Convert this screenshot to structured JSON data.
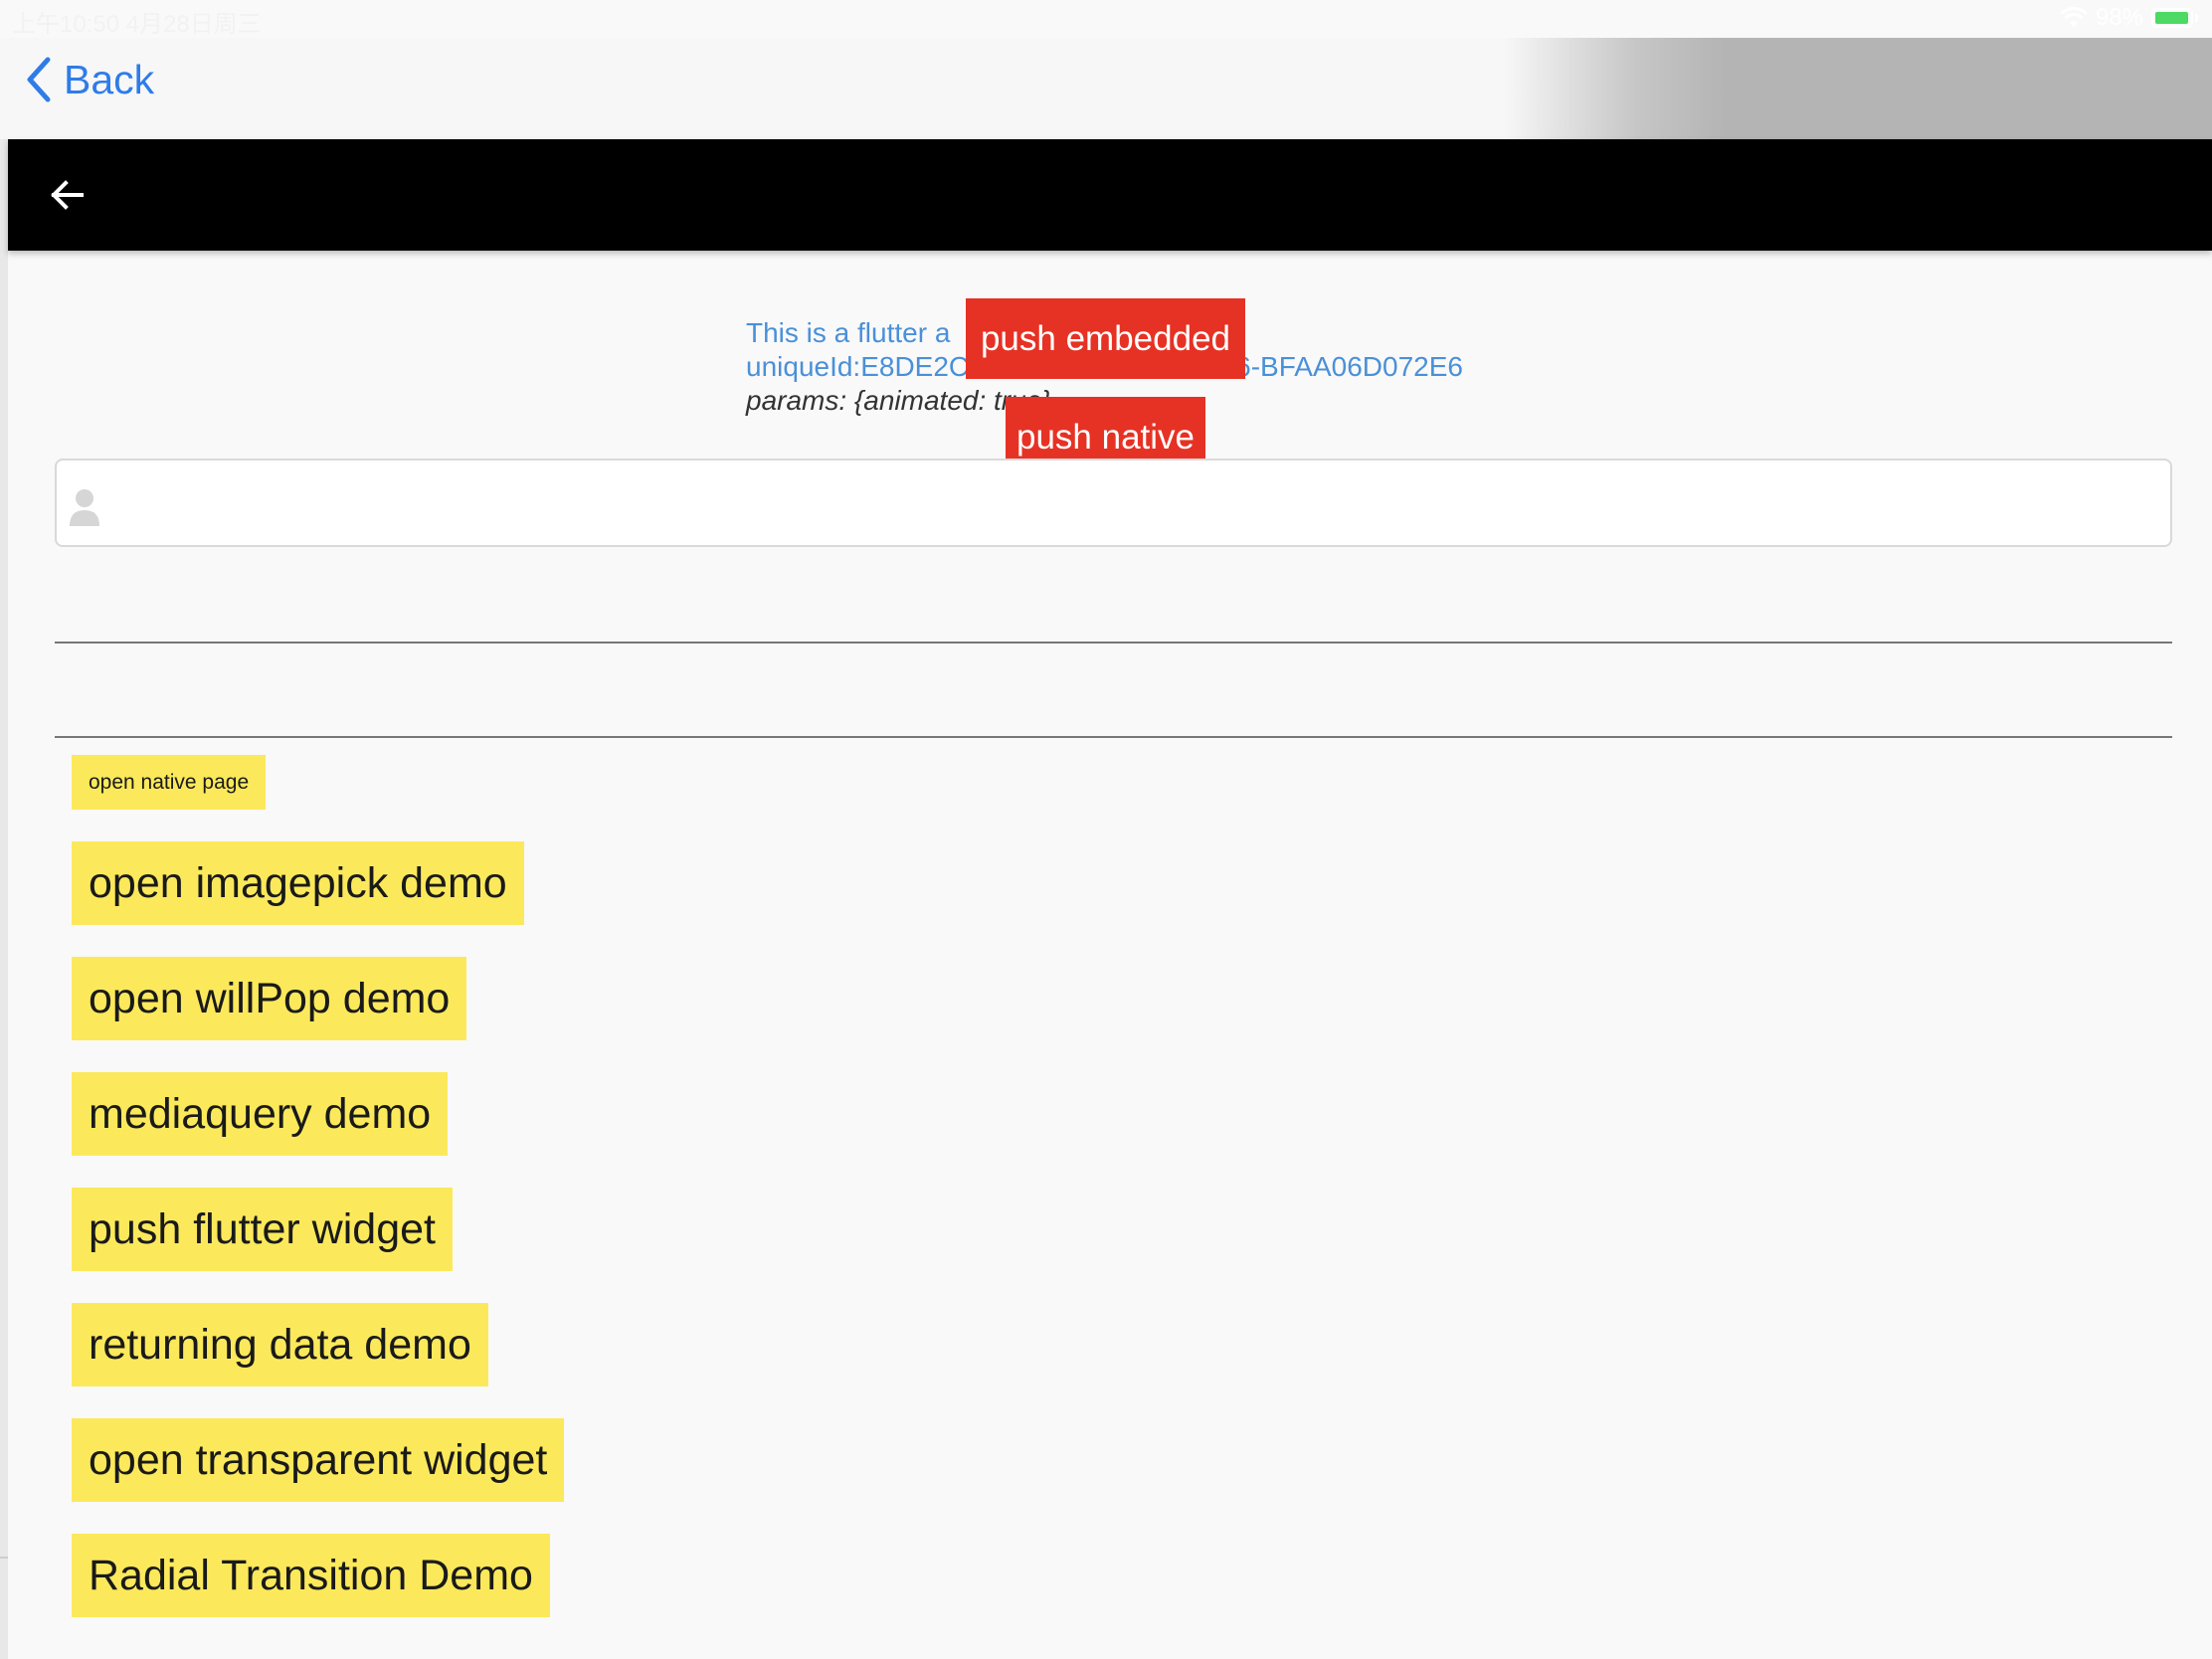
{
  "status_bar": {
    "time": "上午10:50   4月28日周三",
    "battery": "98%",
    "battery_level": 0.98
  },
  "nav": {
    "back_label": "Back"
  },
  "info": {
    "line1": "This is a flutter a",
    "line2_start": "uniqueId:E8DE2C",
    "line2_end": "6-BFAA06D072E6",
    "params": "params: {animated: true}"
  },
  "overlay_buttons": {
    "push_embedded": "push embedded",
    "push_native": "push native"
  },
  "buttons": [
    {
      "label": "open native page"
    },
    {
      "label": "open imagepick demo"
    },
    {
      "label": "open willPop demo"
    },
    {
      "label": "mediaquery demo"
    },
    {
      "label": "push flutter widget"
    },
    {
      "label": "returning data demo"
    },
    {
      "label": "open transparent widget"
    },
    {
      "label": "Radial Transition Demo"
    }
  ],
  "icons": {
    "nav_back": "chevron-left-icon",
    "app_back": "arrow-left-icon",
    "input_prefix": "person-icon",
    "wifi": "wifi-icon",
    "battery": "battery-icon"
  },
  "colors": {
    "accent": "#2f7ce8",
    "app_bar": "#000000",
    "red_button": "#e63224",
    "yellow_button": "#fbe95b"
  }
}
